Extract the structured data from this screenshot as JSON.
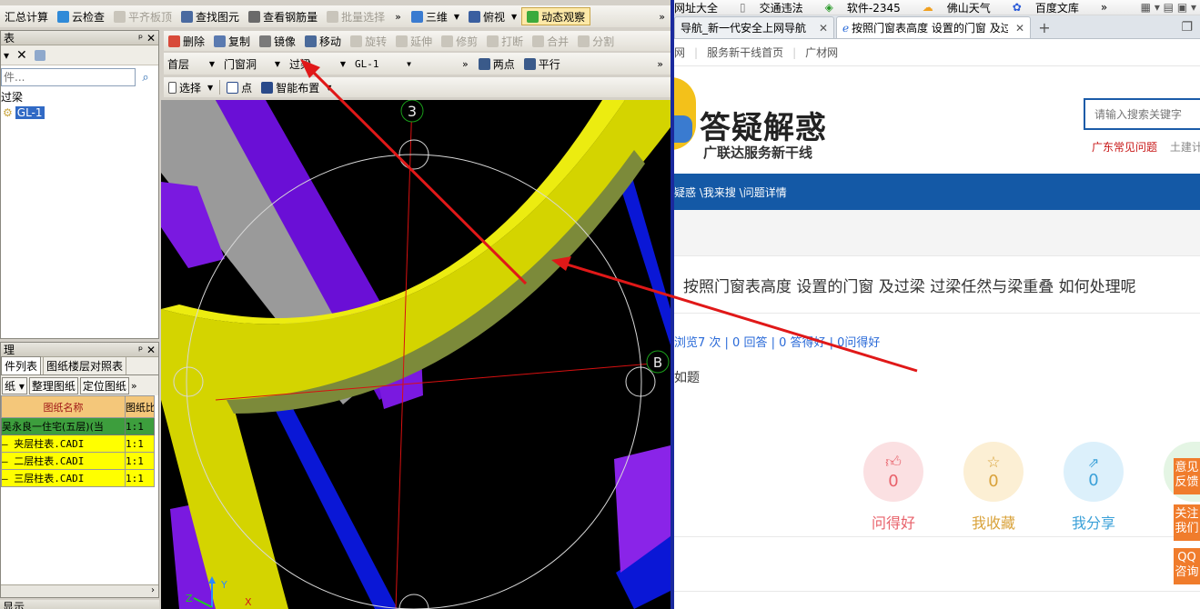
{
  "app": {
    "toolbar1": {
      "summary": "汇总计算",
      "cloud_check": "云检查",
      "flat_slab": "平齐板顶",
      "find_element": "查找图元",
      "view_rebar": "查看钢筋量",
      "batch_select": "批量选择",
      "view_3d": "三维",
      "top_view": "俯视",
      "dynamic_observe": "动态观察"
    },
    "toolbar2": {
      "delete": "删除",
      "copy": "复制",
      "mirror": "镜像",
      "move": "移动",
      "rotate": "旋转",
      "extend": "延伸",
      "trim": "修剪",
      "break": "打断",
      "merge": "合并",
      "split": "分割"
    },
    "toolbar3": {
      "floor": "首层",
      "category": "门窗洞",
      "type": "过梁",
      "element": "GL-1",
      "two_points": "两点",
      "parallel": "平行"
    },
    "toolbar4": {
      "select": "选择",
      "point": "点",
      "smart_place": "智能布置"
    },
    "component_panel": {
      "title": "表",
      "search_placeholder": "件...",
      "tree": [
        {
          "label": "过梁"
        },
        {
          "label": "GL-1"
        }
      ]
    },
    "drawing_panel": {
      "title": "理",
      "tab1": "件列表",
      "tab2": "图纸楼层对照表",
      "btn_drawing": "纸",
      "btn_organize": "整理图纸",
      "btn_locate": "定位图纸",
      "col_name": "图纸名称",
      "col_ratio": "图纸比",
      "rows": [
        {
          "name": "吴永良一住宅(五层)(当",
          "ratio": "1:1"
        },
        {
          "name": "— 夹层柱表.CADI",
          "ratio": "1:1"
        },
        {
          "name": "— 二层柱表.CADI",
          "ratio": "1:1"
        },
        {
          "name": "— 三层柱表.CADI",
          "ratio": "1:1"
        }
      ]
    },
    "axis_3": "3",
    "axis_b": "B",
    "axis_x": "X",
    "axis_y": "Y",
    "axis_z": "Z",
    "bottom_label": "显示"
  },
  "browser": {
    "bookmarks": [
      "网址大全",
      "交通违法",
      "软件-2345",
      "佛山天气",
      "百度文库"
    ],
    "tabs": [
      {
        "label": "导航_新一代安全上网导航"
      },
      {
        "label": "按照门窗表高度 设置的门窗 及过"
      }
    ],
    "nav": [
      "网",
      "服务新干线首页",
      "广材网"
    ],
    "logo_title": "答疑解惑",
    "logo_sub": "广联达服务新干线",
    "search_placeholder": "请输入搜索关键字",
    "hot_links": [
      "广东常见问题",
      "土建计"
    ],
    "breadcrumb": "疑惑 \\我来搜 \\问题详情",
    "question_title": "按照门窗表高度 设置的门窗 及过梁 过梁任然与梁重叠 如何处理呢",
    "stats": "浏览7 次 | 0 回答 | 0 答得好 | 0问得好",
    "subtitle": "如题",
    "actions": [
      {
        "count": "0",
        "label": "问得好",
        "color": "#e8616a"
      },
      {
        "count": "0",
        "label": "我收藏",
        "color": "#d9a23a"
      },
      {
        "count": "0",
        "label": "我分享",
        "color": "#3aa0d8"
      }
    ],
    "side_buttons": [
      "意见反馈",
      "关注我们",
      "QQ咨询"
    ]
  }
}
